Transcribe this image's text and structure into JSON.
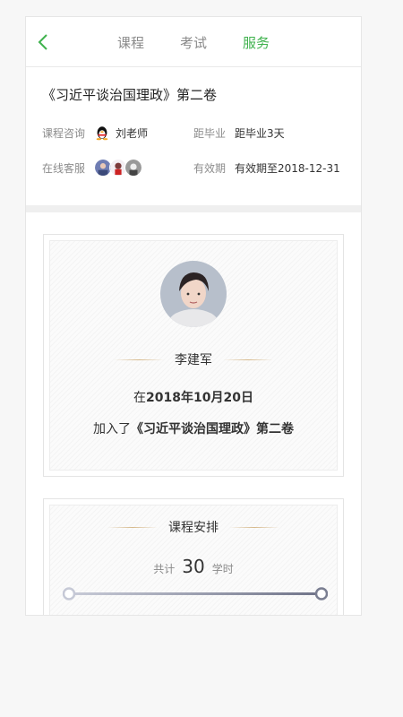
{
  "nav": {
    "tabs": [
      "课程",
      "考试",
      "服务"
    ],
    "active_tab": "服务"
  },
  "course": {
    "title": "《习近平谈治国理政》第二卷"
  },
  "info": {
    "consult_label": "课程咨询",
    "consult_value": "刘老师",
    "graduate_label": "距毕业",
    "graduate_value": "距毕业3天",
    "service_label": "在线客服",
    "valid_label": "有效期",
    "valid_value": "有效期至2018-12-31"
  },
  "certificate": {
    "name": "李建军",
    "date_prefix": "在",
    "date": "2018年10月20日",
    "joined_prefix": "加入了",
    "course": "《习近平谈治国理政》第二卷"
  },
  "schedule": {
    "title": "课程安排",
    "total_prefix": "共计",
    "total_value": "30",
    "total_unit": "学时"
  },
  "colors": {
    "accent": "#3fb24d",
    "gold": "#d6b88a",
    "progress": "#7a7e91"
  }
}
